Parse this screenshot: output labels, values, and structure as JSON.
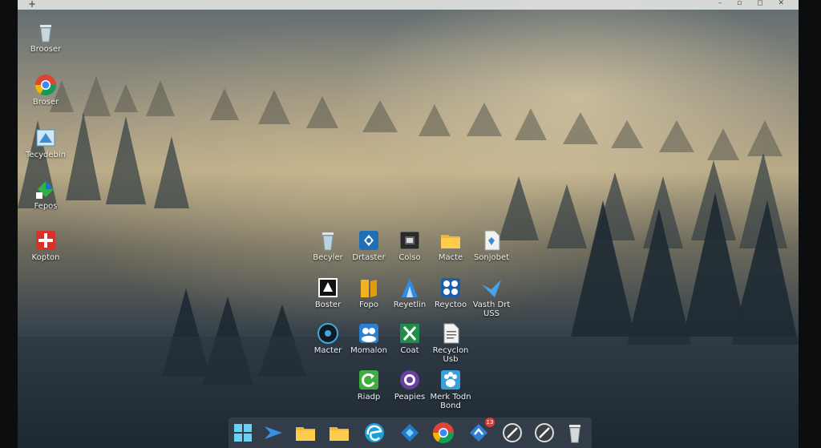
{
  "titlebar": {
    "plus_glyph": "+",
    "controls": "– ▫ ◻ ✕"
  },
  "left_icons": [
    {
      "label": "Brooser",
      "icon": "recycle-bin-icon"
    },
    {
      "label": "Broser",
      "icon": "chrome-icon"
    },
    {
      "label": "Tecydebin",
      "icon": "window-app-icon"
    },
    {
      "label": "Fepos",
      "icon": "green-app-icon"
    },
    {
      "label": "Kopton",
      "icon": "red-app-icon"
    }
  ],
  "grid_icons": [
    {
      "label": "Becyler",
      "icon": "recycle-bin-icon"
    },
    {
      "label": "Drtaster",
      "icon": "blue-app-icon"
    },
    {
      "label": "Colso",
      "icon": "camera-app-icon"
    },
    {
      "label": "Macte",
      "icon": "folder-icon"
    },
    {
      "label": "Sonjobet",
      "icon": "document-icon"
    },
    {
      "label": "Boster",
      "icon": "black-app-icon"
    },
    {
      "label": "Fopo",
      "icon": "yellow-app-icon"
    },
    {
      "label": "Reyetlin",
      "icon": "blue-pen-icon"
    },
    {
      "label": "Reyctoo",
      "icon": "blue-pattern-icon"
    },
    {
      "label": "Vasth Drt USS",
      "icon": "bird-icon"
    },
    {
      "label": "Macter",
      "icon": "disc-icon"
    },
    {
      "label": "Momalon",
      "icon": "people-icon"
    },
    {
      "label": "Coat",
      "icon": "excel-icon"
    },
    {
      "label": "Recyclon Usb",
      "icon": "text-file-icon"
    },
    {
      "label": "Riadp",
      "icon": "green-refresh-icon"
    },
    {
      "label": "Peapies",
      "icon": "purple-circle-icon"
    },
    {
      "label": "Merk Todn Bond",
      "icon": "paw-icon"
    }
  ],
  "taskbar": {
    "items": [
      {
        "icon": "start-icon"
      },
      {
        "icon": "blue-arrow-icon"
      },
      {
        "icon": "folder-icon"
      },
      {
        "icon": "folder-icon"
      },
      {
        "icon": "edge-icon"
      },
      {
        "icon": "blue-arrow-icon"
      },
      {
        "icon": "chrome-icon"
      },
      {
        "icon": "blue-app-icon",
        "badge": "13"
      },
      {
        "icon": "slash-circle-icon"
      },
      {
        "icon": "slash-circle-icon"
      },
      {
        "icon": "recycle-bin-icon"
      }
    ]
  }
}
